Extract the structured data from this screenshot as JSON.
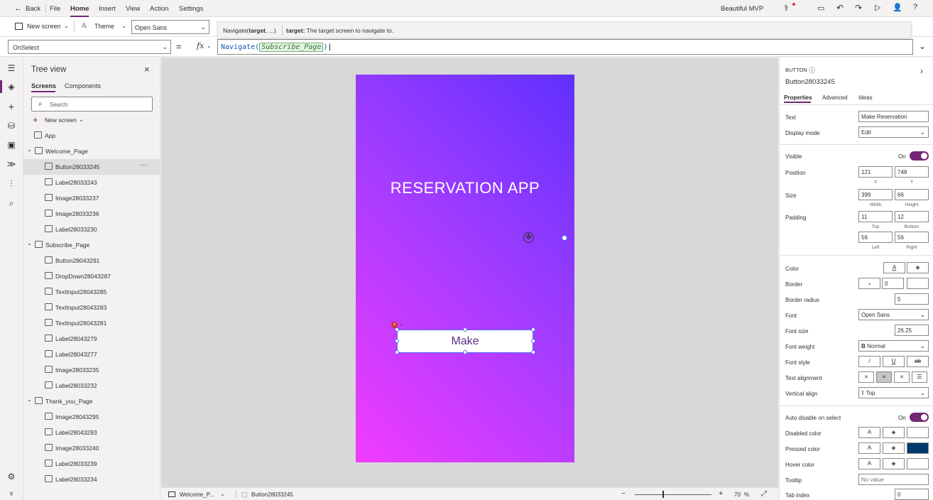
{
  "topbar": {
    "back": "Back",
    "menus": [
      "File",
      "Home",
      "Insert",
      "View",
      "Action",
      "Settings"
    ],
    "app_name": "Beautiful MVP"
  },
  "toolbar": {
    "new_screen": "New screen",
    "theme": "Theme",
    "font": "Open Sans"
  },
  "tooltip": {
    "signature_fn": "Navigate(",
    "signature_arg": "target",
    "signature_rest": ", ...)",
    "arg_name": "target:",
    "arg_desc": "The target screen to navigate to."
  },
  "formulabar": {
    "property": "OnSelect",
    "fx": "fx",
    "fn": "Navigate(",
    "arg": "Subscribe_Page",
    "close": ")"
  },
  "treeview": {
    "title": "Tree view",
    "tabs": [
      "Screens",
      "Components"
    ],
    "search_placeholder": "Search",
    "new_screen": "New screen",
    "items": [
      {
        "label": "App",
        "level": 0
      },
      {
        "label": "Welcome_Page",
        "level": 0
      },
      {
        "label": "Button28033245",
        "level": 1
      },
      {
        "label": "Label28033243",
        "level": 1
      },
      {
        "label": "Image28033237",
        "level": 1
      },
      {
        "label": "Image28033236",
        "level": 1
      },
      {
        "label": "Label28033230",
        "level": 1
      },
      {
        "label": "Subscribe_Page",
        "level": 0
      },
      {
        "label": "Button28043291",
        "level": 1
      },
      {
        "label": "DropDown28043287",
        "level": 1
      },
      {
        "label": "TextInput28043285",
        "level": 1
      },
      {
        "label": "TextInput28043283",
        "level": 1
      },
      {
        "label": "TextInput28043281",
        "level": 1
      },
      {
        "label": "Label28043279",
        "level": 1
      },
      {
        "label": "Label28043277",
        "level": 1
      },
      {
        "label": "Image28033235",
        "level": 1
      },
      {
        "label": "Label28033232",
        "level": 1
      },
      {
        "label": "Thank_you_Page",
        "level": 0
      },
      {
        "label": "Image28043295",
        "level": 1
      },
      {
        "label": "Label28043293",
        "level": 1
      },
      {
        "label": "Image28033240",
        "level": 1
      },
      {
        "label": "Label28033239",
        "level": 1
      },
      {
        "label": "Label28033234",
        "level": 1
      }
    ]
  },
  "canvas": {
    "screen_title": "RESERVATION APP",
    "button_text": "Make"
  },
  "bottombar": {
    "screen": "Welcome_P...",
    "control": "Button28033245",
    "zoom": "70",
    "zoom_unit": "%"
  },
  "props": {
    "type": "BUTTON",
    "name": "Button28033245",
    "tabs": [
      "Properties",
      "Advanced",
      "Ideas"
    ],
    "text_label": "Text",
    "text_value": "Make Reservation",
    "display_mode_label": "Display mode",
    "display_mode_value": "Edit",
    "visible_label": "Visible",
    "visible_state": "On",
    "position_label": "Position",
    "position_x": "121",
    "position_y": "748",
    "x_label": "X",
    "y_label": "Y",
    "size_label": "Size",
    "width": "399",
    "height": "66",
    "width_label": "Width",
    "height_label": "Height",
    "padding_label": "Padding",
    "pad_top": "11",
    "pad_bottom": "12",
    "pad_left": "56",
    "pad_right": "56",
    "top_label": "Top",
    "bottom_label": "Bottom",
    "left_label": "Left",
    "right_label": "Right",
    "color_label": "Color",
    "border_label": "Border",
    "border_value": "0",
    "border_radius_label": "Border radius",
    "border_radius_value": "5",
    "font_label": "Font",
    "font_value": "Open Sans",
    "font_size_label": "Font size",
    "font_size_value": "26.25",
    "font_weight_label": "Font weight",
    "font_weight_value": "Normal",
    "font_style_label": "Font style",
    "text_align_label": "Text alignment",
    "valign_label": "Vertical align",
    "valign_value": "Top",
    "auto_disable_label": "Auto disable on select",
    "auto_disable_state": "On",
    "disabled_color_label": "Disabled color",
    "pressed_color_label": "Pressed color",
    "hover_color_label": "Hover color",
    "tooltip_label": "Tooltip",
    "tooltip_placeholder": "No value",
    "tab_index_label": "Tab index",
    "tab_index_value": "0"
  },
  "colors": {
    "accent": "#742774",
    "gradient_top": "#6030ff",
    "gradient_bottom": "#f23cff",
    "pressed_fill": "#003a6c"
  }
}
